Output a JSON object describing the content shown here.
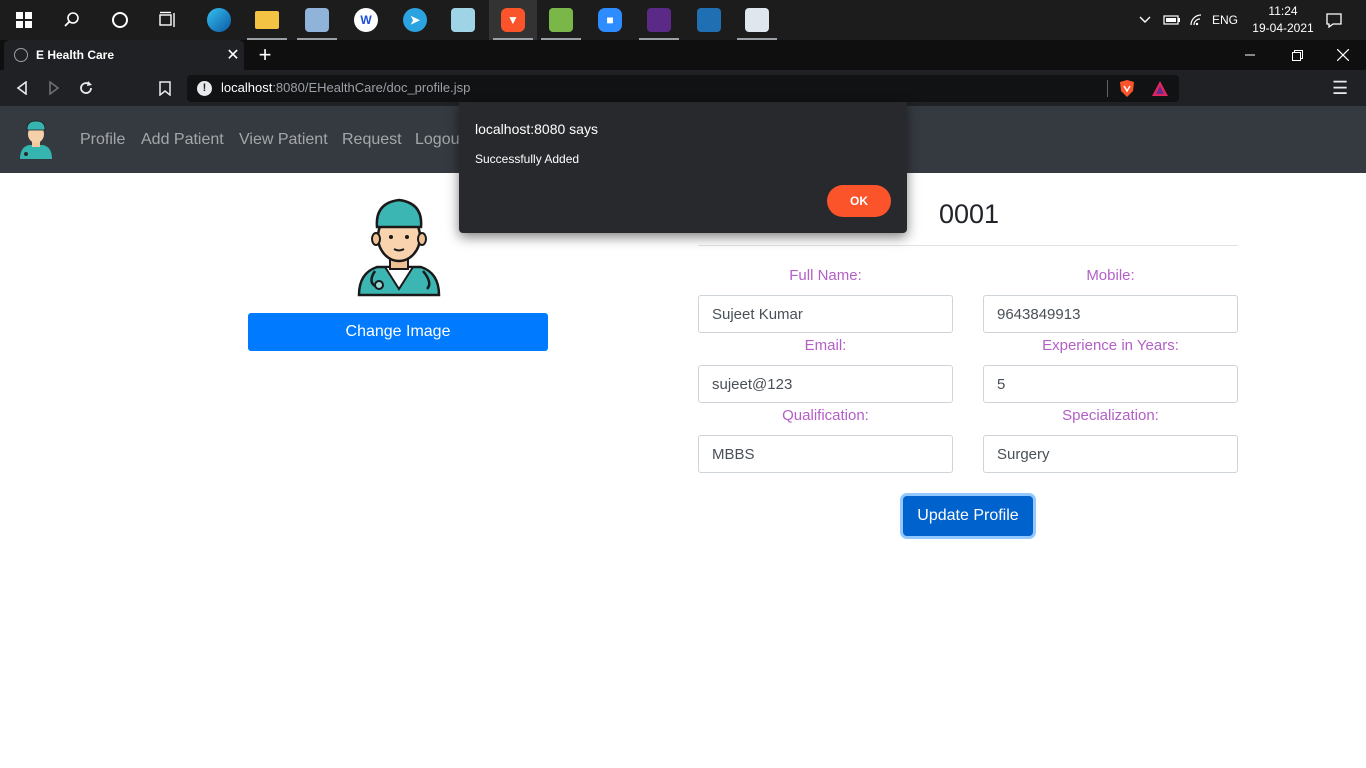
{
  "taskbar": {
    "search_icon": "search-icon",
    "tray_language": "ENG",
    "time": "11:24",
    "date": "19-04-2021"
  },
  "browser": {
    "tab_title": "E Health Care",
    "new_tab": "+",
    "url_host": "localhost",
    "url_rest": ":8080/EHealthCare/doc_profile.jsp"
  },
  "navbar": {
    "links": [
      "Profile",
      "Add Patient",
      "View Patient",
      "Request",
      "Logout"
    ]
  },
  "profile": {
    "change_image_label": "Change Image",
    "doctor_id": "0001",
    "fields": [
      {
        "label": "Full Name:",
        "value": "Sujeet Kumar"
      },
      {
        "label": "Mobile:",
        "value": "9643849913"
      },
      {
        "label": "Email:",
        "value": "sujeet@123"
      },
      {
        "label": "Experience in Years:",
        "value": "5"
      },
      {
        "label": "Qualification:",
        "value": "MBBS"
      },
      {
        "label": "Specialization:",
        "value": "Surgery"
      }
    ],
    "update_label": "Update Profile"
  },
  "dialog": {
    "title": "localhost:8080 says",
    "message": "Successfully Added",
    "ok_label": "OK"
  },
  "colors": {
    "label_purple": "#b35fc7",
    "primary_blue": "#007bff",
    "navbar_dark": "#343a40",
    "dialog_ok": "#fb542b"
  }
}
